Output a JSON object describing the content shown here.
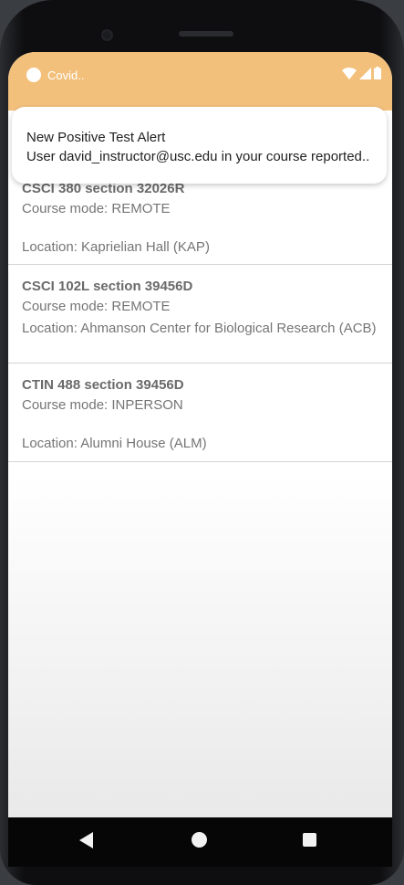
{
  "status_bar": {
    "app_name": "Covid..",
    "icons": [
      "notification-dot-icon",
      "wifi-icon",
      "cellular-signal-icon",
      "battery-icon"
    ]
  },
  "notification": {
    "title": "New Positive Test Alert",
    "text": "User david_instructor@usc.edu in your course reported.."
  },
  "courses": [
    {
      "title": "CSCI 380 section 32026R",
      "mode": "Course mode: REMOTE",
      "location": "Location: Kaprielian Hall (KAP)"
    },
    {
      "title": "CSCI 102L section 39456D",
      "mode": "Course mode: REMOTE",
      "location": "Location: Ahmanson Center for Biological Research (ACB)"
    },
    {
      "title": "CTIN 488 section 39456D",
      "mode": "Course mode: INPERSON",
      "location": "Location: Alumni House (ALM)"
    }
  ],
  "nav_bar": {
    "icons": [
      "back-icon",
      "home-icon",
      "recent-apps-icon"
    ]
  },
  "colors": {
    "status_bar": "#f3c07c",
    "text_secondary": "#757575",
    "divider": "#d3d3d3"
  }
}
